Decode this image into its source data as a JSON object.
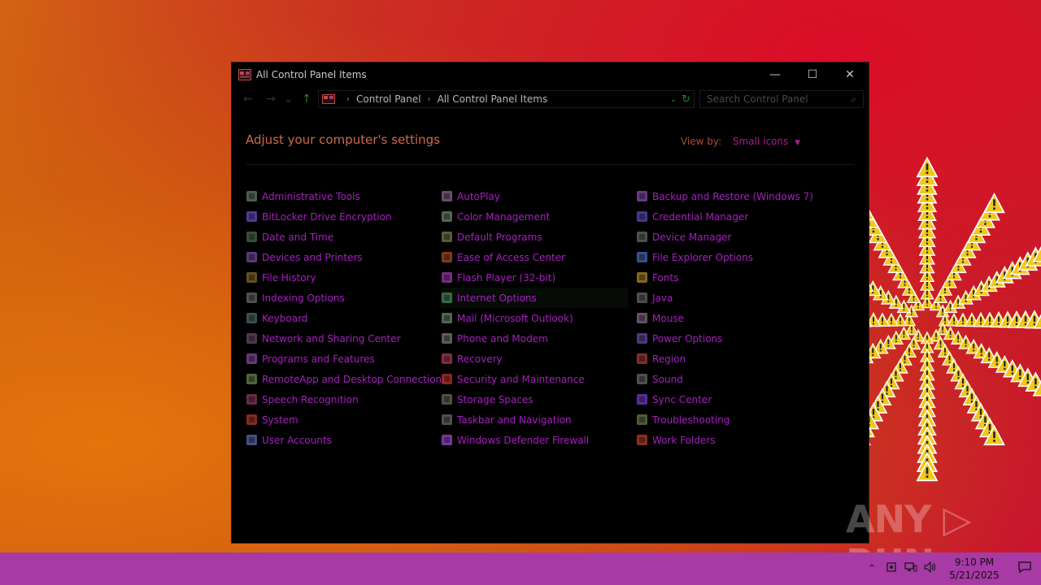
{
  "window": {
    "title": "All Control Panel Items",
    "minimize": "—",
    "maximize": "☐",
    "close": "✕"
  },
  "navbar": {
    "back": "←",
    "forward": "→",
    "recent": "⌄",
    "up": "↑",
    "breadcrumb": [
      "Control Panel",
      "All Control Panel Items"
    ],
    "separator": "›",
    "dropdown": "⌄",
    "refresh": "↻",
    "search_placeholder": "Search Control Panel",
    "search_icon": "⌕"
  },
  "content": {
    "heading": "Adjust your computer's settings",
    "view_by_label": "View by:",
    "view_by_value": "Small icons",
    "view_by_caret": "▼"
  },
  "items": [
    {
      "label": "Administrative Tools",
      "icon": "admin-tools-icon",
      "color": "#6a7a6a"
    },
    {
      "label": "BitLocker Drive Encryption",
      "icon": "bitlocker-icon",
      "color": "#6a4ad0"
    },
    {
      "label": "Date and Time",
      "icon": "clock-icon",
      "color": "#4a6a4a"
    },
    {
      "label": "Devices and Printers",
      "icon": "printer-icon",
      "color": "#7a4aa0"
    },
    {
      "label": "File History",
      "icon": "file-history-icon",
      "color": "#8a6a2a"
    },
    {
      "label": "Indexing Options",
      "icon": "indexing-icon",
      "color": "#6a6a6a"
    },
    {
      "label": "Keyboard",
      "icon": "keyboard-icon",
      "color": "#4a6a6a"
    },
    {
      "label": "Network and Sharing Center",
      "icon": "network-icon",
      "color": "#6a4a6a"
    },
    {
      "label": "Programs and Features",
      "icon": "programs-icon",
      "color": "#8a4aa0"
    },
    {
      "label": "RemoteApp and Desktop Connections",
      "icon": "remoteapp-icon",
      "color": "#6a8a4a"
    },
    {
      "label": "Speech Recognition",
      "icon": "microphone-icon",
      "color": "#8a3a5a"
    },
    {
      "label": "System",
      "icon": "system-icon",
      "color": "#b03a2a"
    },
    {
      "label": "User Accounts",
      "icon": "user-accounts-icon",
      "color": "#5a6ab0"
    },
    {
      "label": "AutoPlay",
      "icon": "autoplay-icon",
      "color": "#8a6a8a"
    },
    {
      "label": "Color Management",
      "icon": "color-management-icon",
      "color": "#6a8a6a"
    },
    {
      "label": "Default Programs",
      "icon": "default-programs-icon",
      "color": "#7a7a4a"
    },
    {
      "label": "Ease of Access Center",
      "icon": "ease-of-access-icon",
      "color": "#b04a2a"
    },
    {
      "label": "Flash Player (32-bit)",
      "icon": "flash-icon",
      "color": "#a03ab0"
    },
    {
      "label": "Internet Options",
      "icon": "internet-options-icon",
      "color": "#4a8a5a"
    },
    {
      "label": "Mail (Microsoft Outlook)",
      "icon": "mail-icon",
      "color": "#6a8a6a"
    },
    {
      "label": "Phone and Modem",
      "icon": "phone-icon",
      "color": "#7a7a7a"
    },
    {
      "label": "Recovery",
      "icon": "recovery-icon",
      "color": "#b03a5a"
    },
    {
      "label": "Security and Maintenance",
      "icon": "flag-icon",
      "color": "#c0302a"
    },
    {
      "label": "Storage Spaces",
      "icon": "storage-icon",
      "color": "#6a6a5a"
    },
    {
      "label": "Taskbar and Navigation",
      "icon": "taskbar-icon",
      "color": "#6a6a6a"
    },
    {
      "label": "Windows Defender Firewall",
      "icon": "firewall-icon",
      "color": "#a04ad0"
    },
    {
      "label": "Backup and Restore (Windows 7)",
      "icon": "backup-icon",
      "color": "#8a4ab0"
    },
    {
      "label": "Credential Manager",
      "icon": "credential-icon",
      "color": "#5a4ac0"
    },
    {
      "label": "Device Manager",
      "icon": "device-manager-icon",
      "color": "#6a6a6a"
    },
    {
      "label": "File Explorer Options",
      "icon": "folder-options-icon",
      "color": "#4a6ac0"
    },
    {
      "label": "Fonts",
      "icon": "fonts-icon",
      "color": "#b08a2a"
    },
    {
      "label": "Java",
      "icon": "java-icon",
      "color": "#6a6a6a"
    },
    {
      "label": "Mouse",
      "icon": "mouse-icon",
      "color": "#8a6a8a"
    },
    {
      "label": "Power Options",
      "icon": "power-icon",
      "color": "#6a4ab0"
    },
    {
      "label": "Region",
      "icon": "region-icon",
      "color": "#b03a3a"
    },
    {
      "label": "Sound",
      "icon": "sound-icon",
      "color": "#6a6a6a"
    },
    {
      "label": "Sync Center",
      "icon": "sync-icon",
      "color": "#7a3ad0"
    },
    {
      "label": "Troubleshooting",
      "icon": "troubleshooting-icon",
      "color": "#6a7a4a"
    },
    {
      "label": "Work Folders",
      "icon": "work-folders-icon",
      "color": "#c03a2a"
    }
  ],
  "highlighted_item": "Internet Options",
  "watermark": "ANY ▷ RUN",
  "taskbar": {
    "time": "9:10 PM",
    "date": "5/21/2025",
    "tray_chevron": "⌃",
    "notifications_icon": "🗨"
  },
  "colors": {
    "taskbar": "#a73aa5",
    "item_text": "#a71fc0",
    "heading": "#cc6a4a",
    "window_bg": "#000000"
  }
}
